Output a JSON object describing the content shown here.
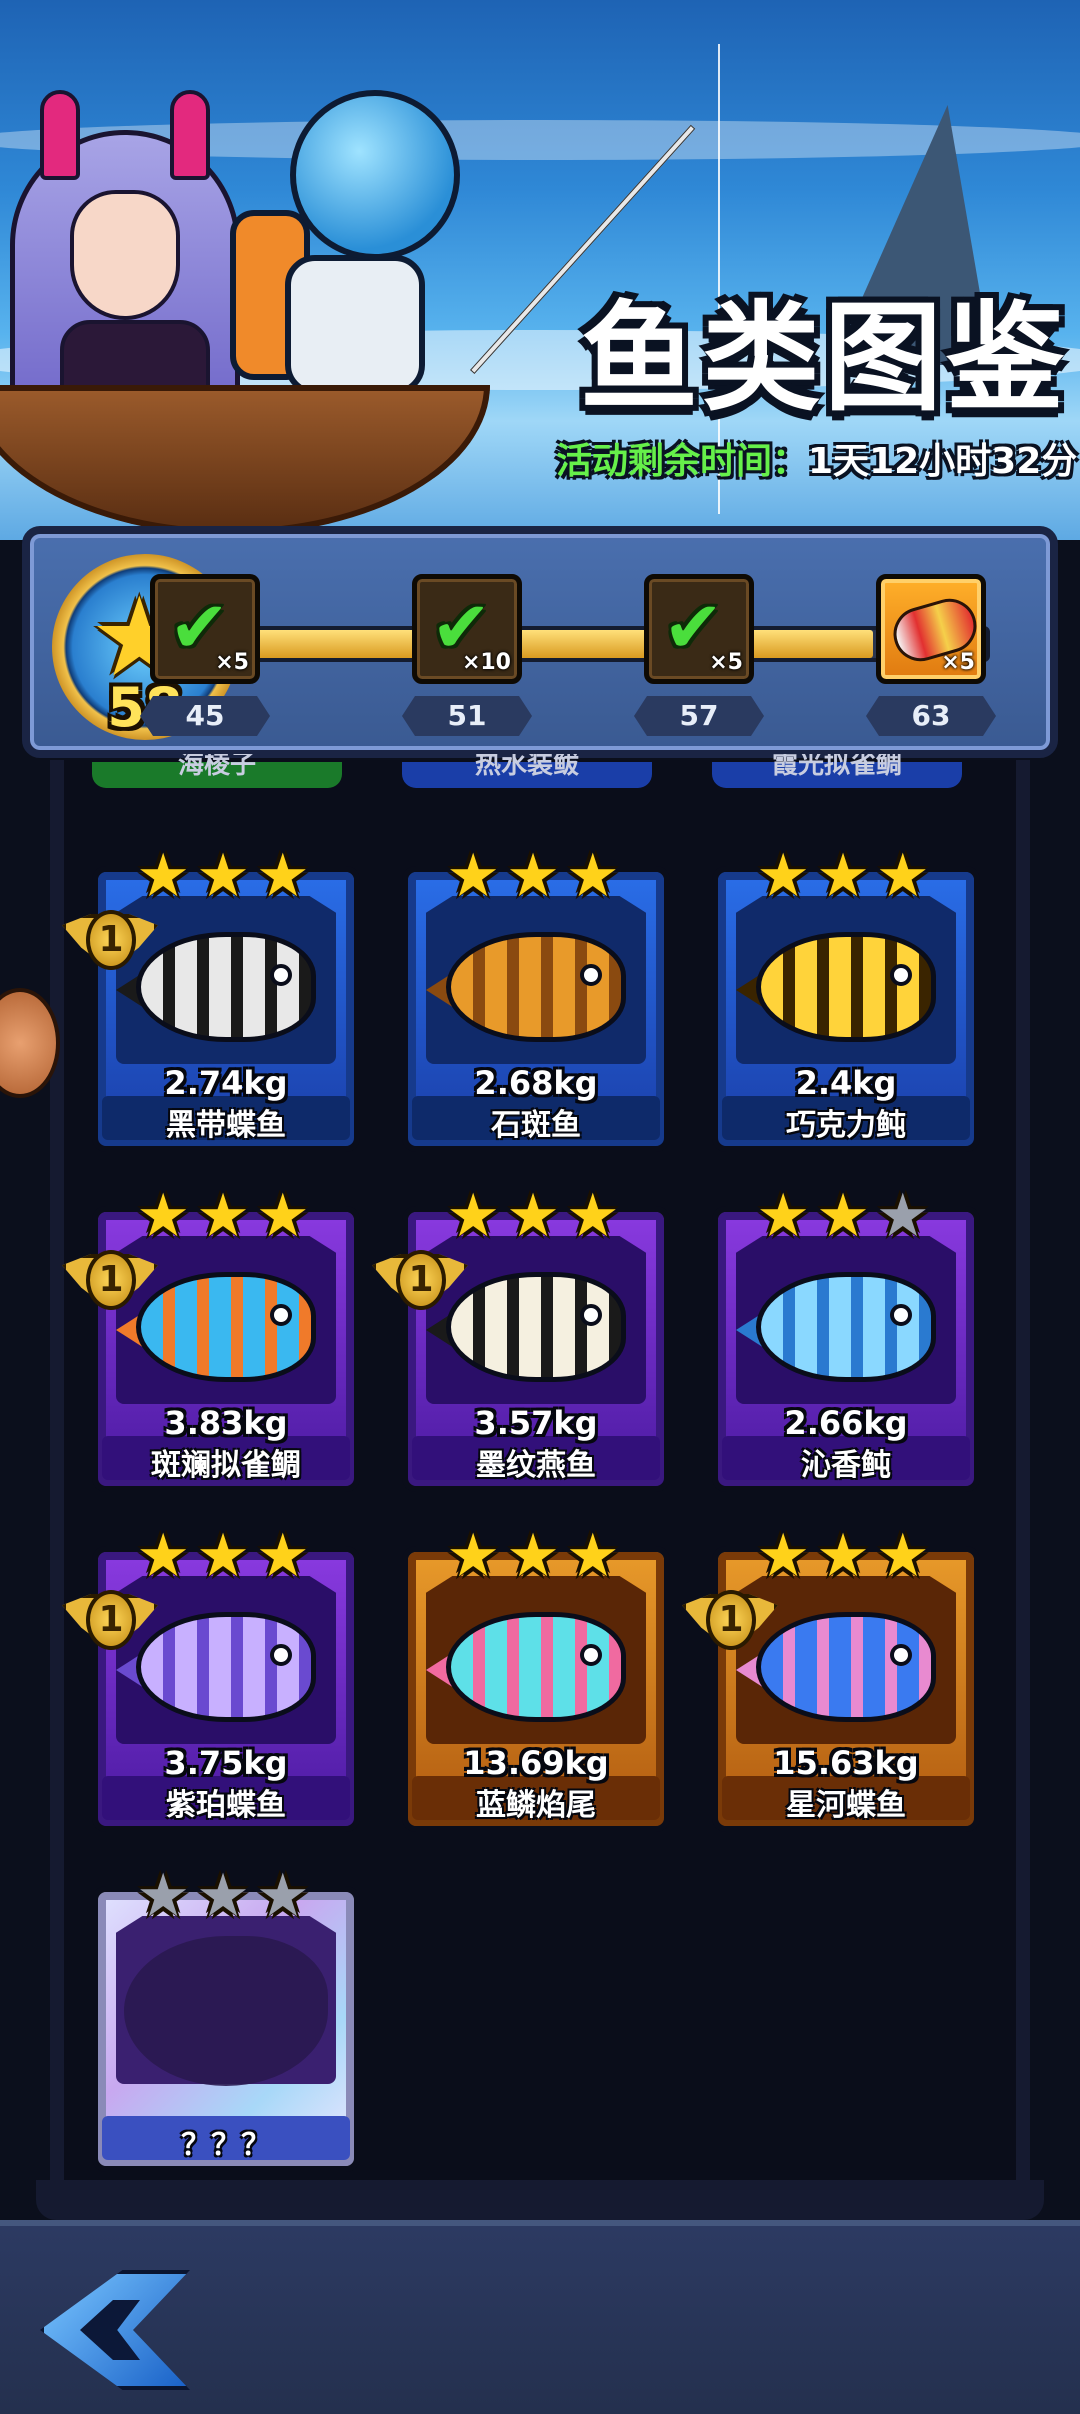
{
  "header": {
    "title": "鱼类图鉴",
    "timer_label": "活动剩余时间：",
    "timer_value": "1天12小时32分"
  },
  "progress": {
    "current_level": "58",
    "fill_fraction": 0.85,
    "milestones": [
      {
        "level": "45",
        "quantity": "×5",
        "claimed": true
      },
      {
        "level": "51",
        "quantity": "×10",
        "claimed": true
      },
      {
        "level": "57",
        "quantity": "×5",
        "claimed": true
      },
      {
        "level": "63",
        "quantity": "×5",
        "claimed": false,
        "icon": "lure-icon"
      }
    ]
  },
  "peek_row": [
    {
      "name": "海棱子"
    },
    {
      "name": "热水装鲅"
    },
    {
      "name": "霞光拟雀鲷"
    }
  ],
  "cards": [
    {
      "name": "黑带蝶鱼",
      "weight": "2.74kg",
      "stars": 3,
      "rarity": "blue",
      "rank": "1",
      "colors": [
        "#e8e8e8",
        "#1a1a1a"
      ]
    },
    {
      "name": "石斑鱼",
      "weight": "2.68kg",
      "stars": 3,
      "rarity": "blue",
      "rank": "",
      "colors": [
        "#e89a2a",
        "#8a4a10"
      ]
    },
    {
      "name": "巧克力鲀",
      "weight": "2.4kg",
      "stars": 3,
      "rarity": "blue",
      "rank": "",
      "colors": [
        "#ffd33a",
        "#3a2400"
      ]
    },
    {
      "name": "斑斓拟雀鲷",
      "weight": "3.83kg",
      "stars": 3,
      "rarity": "purple",
      "rank": "1",
      "colors": [
        "#3ab8f0",
        "#f07a2a"
      ]
    },
    {
      "name": "墨纹燕鱼",
      "weight": "3.57kg",
      "stars": 3,
      "rarity": "purple",
      "rank": "1",
      "colors": [
        "#f5f0e0",
        "#1a1a1a"
      ]
    },
    {
      "name": "沁香鲀",
      "weight": "2.66kg",
      "stars": 2,
      "rarity": "purple",
      "rank": "",
      "colors": [
        "#8ad8ff",
        "#2a7ad0"
      ]
    },
    {
      "name": "紫珀蝶鱼",
      "weight": "3.75kg",
      "stars": 3,
      "rarity": "purple",
      "rank": "1",
      "colors": [
        "#c8b0ff",
        "#6a4ad0"
      ]
    },
    {
      "name": "蓝鳞焰尾",
      "weight": "13.69kg",
      "stars": 3,
      "rarity": "orange",
      "rank": "",
      "colors": [
        "#5ee0e8",
        "#f06aa0"
      ]
    },
    {
      "name": "星河蝶鱼",
      "weight": "15.63kg",
      "stars": 3,
      "rarity": "orange",
      "rank": "1",
      "colors": [
        "#3a7af0",
        "#e88ad0"
      ]
    },
    {
      "name": "？？？",
      "weight": "",
      "stars": 0,
      "rarity": "locked",
      "rank": "",
      "colors": [
        "#2a1850",
        "#2a1850"
      ]
    }
  ],
  "footer": {
    "back_icon": "back-arrow-icon"
  }
}
